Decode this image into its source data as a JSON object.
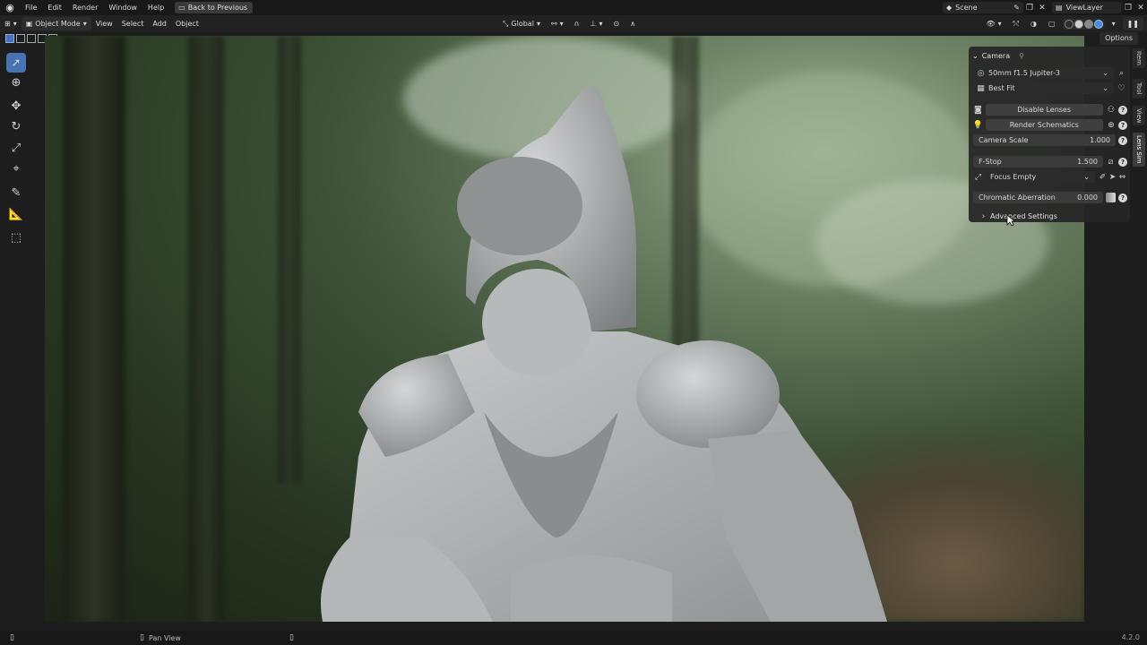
{
  "menubar": {
    "items": [
      "File",
      "Edit",
      "Render",
      "Window",
      "Help"
    ],
    "back_button": "Back to Previous",
    "scene": "Scene",
    "view_layer": "ViewLayer"
  },
  "viewport_header": {
    "mode": "Object Mode",
    "menus": [
      "View",
      "Select",
      "Add",
      "Object"
    ],
    "transform_orientation": "Global",
    "options_label": "Options"
  },
  "npanel": {
    "panel_title": "Camera",
    "lens_preset": "50mm f1.5 Jupiter-3",
    "fit_mode": "Best Fit",
    "disable_lenses_label": "Disable Lenses",
    "render_schematics_label": "Render Schematics",
    "camera_scale": {
      "label": "Camera Scale",
      "value": "1.000"
    },
    "fstop": {
      "label": "F-Stop",
      "value": "1.500"
    },
    "focus_object": "Focus Empty",
    "chromatic_aberration": {
      "label": "Chromatic Aberration",
      "value": "0.000"
    },
    "advanced_settings_label": "Advanced Settings"
  },
  "sidebar_tabs": [
    "Item",
    "Tool",
    "View",
    "Lens Sim"
  ],
  "statusbar": {
    "hint": "Pan View",
    "version": "4.2.0"
  },
  "colors": {
    "accent": "#4772b3",
    "panel_bg": "#262626",
    "field_bg": "#3a3a3a"
  }
}
